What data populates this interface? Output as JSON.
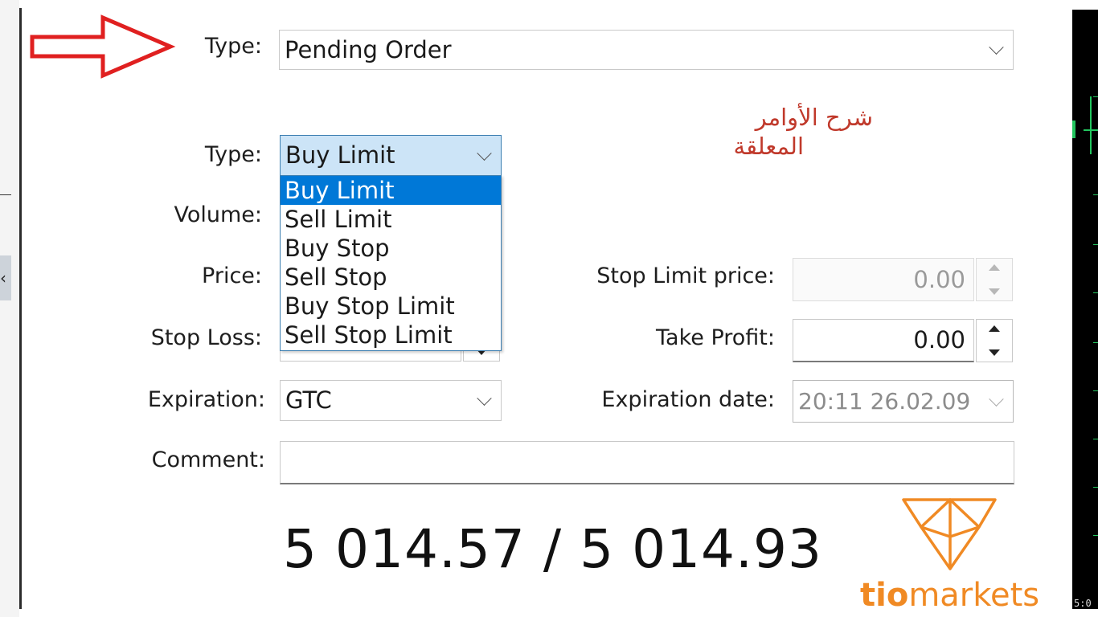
{
  "form": {
    "order_type_label": "Type:",
    "order_type_value": "Pending Order",
    "pending_type_label": "Type:",
    "pending_type_value": "Buy Limit",
    "pending_type_options": [
      "Buy Limit",
      "Sell Limit",
      "Buy Stop",
      "Sell Stop",
      "Buy Stop Limit",
      "Sell Stop Limit"
    ],
    "volume_label": "Volume:",
    "price_label": "Price:",
    "stop_limit_label": "Stop Limit price:",
    "stop_limit_value": "0.00",
    "stop_loss_label": "Stop Loss:",
    "take_profit_label": "Take Profit:",
    "take_profit_value": "0.00",
    "expiration_label": "Expiration:",
    "expiration_value": "GTC",
    "expiration_date_label": "Expiration date:",
    "expiration_date_value": "20:11 26.02.09",
    "comment_label": "Comment:",
    "comment_value": ""
  },
  "annotation": {
    "arabic_line1": "شرح الأوامر",
    "arabic_line2": "المعلقة",
    "arrow_color": "#e02020"
  },
  "quote": {
    "bid_ask": "5 014.57 / 5 014.93"
  },
  "brand": {
    "part1": "tio",
    "part2": "markets",
    "color": "#f08a24"
  },
  "chart_strip": {
    "time_label": "5:0"
  }
}
